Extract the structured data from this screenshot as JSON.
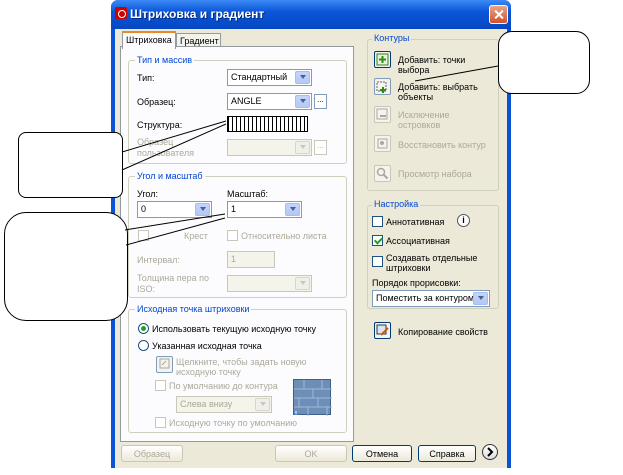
{
  "window": {
    "title": "Штриховка и градиент"
  },
  "tabs": [
    {
      "label": "Штриховка"
    },
    {
      "label": "Градиент"
    }
  ],
  "type_pattern": {
    "group_label": "Тип и массив",
    "type_label": "Тип:",
    "type_value": "Стандартный",
    "pattern_label": "Образец:",
    "pattern_value": "ANGLE",
    "structure_label": "Структура:",
    "custom_label": "Образец пользователя",
    "browse_label": "..."
  },
  "angle_scale": {
    "group_label": "Угол и масштаб",
    "angle_label": "Угол:",
    "angle_value": "0",
    "scale_label": "Масштаб:",
    "scale_value": "1",
    "cross_label": "Крест",
    "relative_label": "Относительно листа",
    "spacing_label": "Интервал:",
    "spacing_value": "1",
    "iso_pen_label": "Толщина пера по ISO:"
  },
  "origin": {
    "group_label": "Исходная точка штриховки",
    "use_current_label": "Использовать текущую исходную точку",
    "specified_label": "Указанная исходная точка",
    "click_set_label": "Щелкните, чтобы задать новую исходную точку",
    "default_to_bounds_label": "По умолчанию до контура",
    "position_value": "Слева внизу",
    "store_default_label": "Исходную точку по умолчанию"
  },
  "boundaries": {
    "group_label": "Контуры",
    "add_pick_label": "Добавить: точки выбора",
    "add_select_label": "Добавить: выбрать объекты",
    "remove_label": "Исключение островков",
    "recreate_label": "Восстановить контур",
    "view_label": "Просмотр набора"
  },
  "options": {
    "group_label": "Настройка",
    "annotative_label": "Аннотативная",
    "associative_label": "Ассоциативная",
    "separate_label": "Создавать отдельные штриховки",
    "draw_order_label": "Порядок прорисовки:",
    "draw_order_value": "Поместить за контуром",
    "inherit_label": "Копирование свойств"
  },
  "footer": {
    "preview_label": "Образец",
    "ok_label": "OK",
    "cancel_label": "Отмена",
    "help_label": "Справка"
  },
  "colors": {
    "title_bar": "#0a56d8",
    "dialog_bg": "#ece9d8",
    "group_label": "#0046d5"
  }
}
